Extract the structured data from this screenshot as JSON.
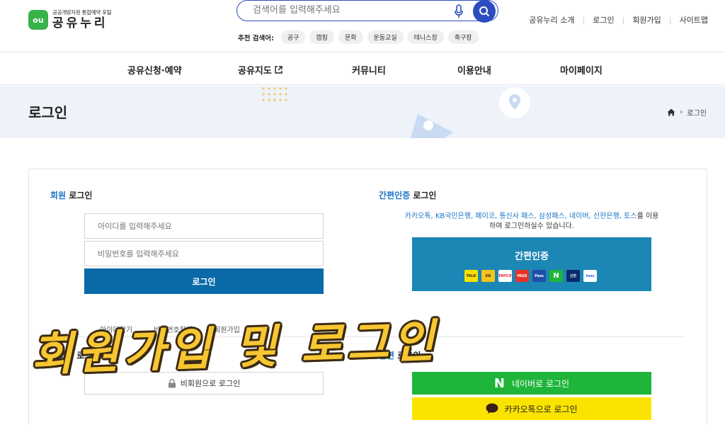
{
  "header": {
    "logo_mark": "ou",
    "logo_sub": "공공개방자원 통합예약 포털",
    "logo_main": "공유누리",
    "search_placeholder": "검색어를 입력해주세요",
    "recommend_label": "추천 검색어:",
    "recommend_tags": [
      "공구",
      "캠핑",
      "문화",
      "운동교실",
      "테니스장",
      "축구장"
    ],
    "top_links": [
      "공유누리 소개",
      "로그인",
      "회원가입",
      "사이트맵"
    ]
  },
  "gnb": {
    "items": [
      "공유신청·예약",
      "공유지도",
      "커뮤니티",
      "이용안내",
      "마이페이지"
    ]
  },
  "banner": {
    "title": "로그인",
    "breadcrumb_current": "로그인"
  },
  "member_login": {
    "title_accent": "회원",
    "title_rest": " 로그인",
    "id_placeholder": "아이디를 입력해주세요",
    "pw_placeholder": "비밀번호를 입력해주세요",
    "login_label": "로그인",
    "find_links": [
      "아이디찾기",
      "비밀번호찾기",
      "회원가입"
    ]
  },
  "nonmember": {
    "title_accent": "비회원",
    "title_rest": " 로그인",
    "button_label": "비회원으로 로그인"
  },
  "simple_auth": {
    "title_accent": "간편인증",
    "title_rest": " 로그인",
    "desc_blue": "카카오톡, KB국민은행, 페이코, 통신사 패스, 삼성패스, 네이버, 신한은행, 토스",
    "desc_rest": "를 이용하여 로그인하실수 있습니다.",
    "button_label": "간편인증",
    "providers": [
      "TALK",
      "KB",
      "PAYCO",
      "PASS",
      "Pass",
      "N",
      "신한",
      "toss"
    ]
  },
  "sns_login": {
    "title_accent": "간편",
    "title_rest": " 로그인",
    "naver_label": "네이버로 로그인",
    "kakao_label": "카카오톡으로 로그인"
  },
  "caption": "회원가입 및 로그인",
  "colors": {
    "primary_blue": "#2b4dbf",
    "login_button": "#0a6aa8",
    "simple_auth": "#1c86b4",
    "naver": "#1eb53a",
    "kakao": "#fbe300",
    "accent_text": "#1a73c7",
    "caption": "#f7c631"
  }
}
